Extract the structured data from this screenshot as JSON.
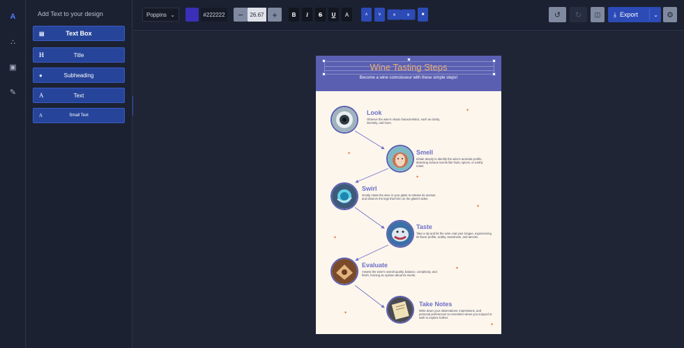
{
  "rail": {
    "items": [
      {
        "name": "text-tool-icon",
        "glyph": "A"
      },
      {
        "name": "shapes-tool-icon",
        "glyph": "∴"
      },
      {
        "name": "image-tool-icon",
        "glyph": "▣"
      },
      {
        "name": "brush-tool-icon",
        "glyph": "✎"
      }
    ]
  },
  "panel": {
    "heading": "Add Text to your design",
    "buttons": [
      {
        "label": "Text Box",
        "icon": "▤"
      },
      {
        "label": "Title",
        "icon": "H"
      },
      {
        "label": "Subheading",
        "icon": "●"
      },
      {
        "label": "Text",
        "icon": "A"
      },
      {
        "label": "Small Text",
        "icon": "A"
      }
    ]
  },
  "toolbar": {
    "font": "Poppins",
    "color_hex": "#222222",
    "font_size": "26.67",
    "format_buttons": [
      "B",
      "I",
      "S",
      "U",
      "A"
    ],
    "layer_buttons": [
      "˄",
      "˅",
      "»",
      "«",
      "■"
    ],
    "export_label": "Export"
  },
  "artboard": {
    "title": "Wine Tasting Steps",
    "subtitle": "Become a wine connoisseur with these simple steps!",
    "steps": [
      {
        "title": "Look",
        "desc": "Observe the wine's visual characteristics, such as clarity, intensity, and hues."
      },
      {
        "title": "Smell",
        "desc": "Inhale deeply to identify the wine's aromatic profile, detecting various scents like fruits, spices, or earthy notes."
      },
      {
        "title": "Swirl",
        "desc": "Gently rotate the wine in your glass to release its aromas and observe the legs that form on the glass's sides."
      },
      {
        "title": "Taste",
        "desc": "Take a sip and let the wine coat your tongue, experiencing its flavor profile, acidity, sweetness, and tannins."
      },
      {
        "title": "Evaluate",
        "desc": "Assess the wine's overall quality, balance, complexity, and finish, forming an opinion about its merits."
      },
      {
        "title": "Take Notes",
        "desc": "Write down your observations, impressions, and personal preferences to remember wines you enjoyed or wish to explore further."
      }
    ]
  },
  "colors": {
    "accent": "#2c4bb7",
    "banner": "#5b5fb2",
    "title_orange": "#f4b266",
    "step_title": "#6c70c8",
    "artboard_bg": "#fdf6ec"
  }
}
